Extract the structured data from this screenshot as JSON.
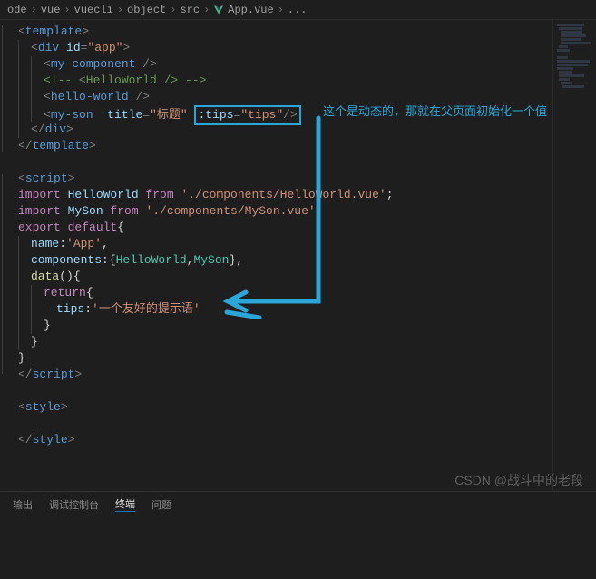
{
  "breadcrumb": {
    "items": [
      "ode",
      "vue",
      "vuecli",
      "object",
      "src",
      "App.vue",
      "..."
    ]
  },
  "code": {
    "lines": [
      {
        "indent": 0,
        "tokens": [
          {
            "c": "tag",
            "t": "<"
          },
          {
            "c": "tagname",
            "t": "template"
          },
          {
            "c": "tag",
            "t": ">"
          }
        ]
      },
      {
        "indent": 1,
        "tokens": [
          {
            "c": "tag",
            "t": "<"
          },
          {
            "c": "tagname",
            "t": "div "
          },
          {
            "c": "attr",
            "t": "id"
          },
          {
            "c": "tag",
            "t": "="
          },
          {
            "c": "string",
            "t": "\"app\""
          },
          {
            "c": "tag",
            "t": ">"
          }
        ]
      },
      {
        "indent": 2,
        "tokens": [
          {
            "c": "tag",
            "t": "<"
          },
          {
            "c": "tagname",
            "t": "my-component"
          },
          {
            "c": "tag",
            "t": " />"
          }
        ]
      },
      {
        "indent": 2,
        "tokens": [
          {
            "c": "comment",
            "t": "<!-- <HelloWorld /> -->"
          }
        ]
      },
      {
        "indent": 2,
        "tokens": [
          {
            "c": "tag",
            "t": "<"
          },
          {
            "c": "tagname",
            "t": "hello-world"
          },
          {
            "c": "tag",
            "t": " />"
          }
        ]
      },
      {
        "indent": 2,
        "special": "myson"
      },
      {
        "indent": 1,
        "tokens": [
          {
            "c": "tag",
            "t": "</"
          },
          {
            "c": "tagname",
            "t": "div"
          },
          {
            "c": "tag",
            "t": ">"
          }
        ]
      },
      {
        "indent": 0,
        "tokens": [
          {
            "c": "tag",
            "t": "</"
          },
          {
            "c": "tagname",
            "t": "template"
          },
          {
            "c": "tag",
            "t": ">"
          }
        ]
      },
      {
        "indent": 0,
        "tokens": []
      },
      {
        "indent": 0,
        "tokens": [
          {
            "c": "tag",
            "t": "<"
          },
          {
            "c": "tagname",
            "t": "script"
          },
          {
            "c": "tag",
            "t": ">"
          }
        ]
      },
      {
        "indent": 0,
        "tokens": [
          {
            "c": "keyword",
            "t": "import "
          },
          {
            "c": "identifier",
            "t": "HelloWorld "
          },
          {
            "c": "keyword",
            "t": "from "
          },
          {
            "c": "string",
            "t": "'./components/HelloWorld.vue'"
          },
          {
            "c": "punct",
            "t": ";"
          }
        ]
      },
      {
        "indent": 0,
        "tokens": [
          {
            "c": "keyword",
            "t": "import "
          },
          {
            "c": "identifier",
            "t": "MySon "
          },
          {
            "c": "keyword",
            "t": "from "
          },
          {
            "c": "string",
            "t": "'./components/MySon.vue'"
          }
        ]
      },
      {
        "indent": 0,
        "tokens": [
          {
            "c": "keyword",
            "t": "export default"
          },
          {
            "c": "punct",
            "t": "{"
          }
        ]
      },
      {
        "indent": 1,
        "tokens": [
          {
            "c": "identifier",
            "t": "name"
          },
          {
            "c": "punct",
            "t": ":"
          },
          {
            "c": "string",
            "t": "'App'"
          },
          {
            "c": "punct",
            "t": ","
          }
        ]
      },
      {
        "indent": 1,
        "tokens": [
          {
            "c": "identifier",
            "t": "components"
          },
          {
            "c": "punct",
            "t": ":{"
          },
          {
            "c": "class",
            "t": "HelloWorld"
          },
          {
            "c": "punct",
            "t": ","
          },
          {
            "c": "class",
            "t": "MySon"
          },
          {
            "c": "punct",
            "t": "},"
          }
        ]
      },
      {
        "indent": 1,
        "tokens": [
          {
            "c": "func",
            "t": "data"
          },
          {
            "c": "punct",
            "t": "(){"
          }
        ]
      },
      {
        "indent": 2,
        "tokens": [
          {
            "c": "keyword",
            "t": "return"
          },
          {
            "c": "punct",
            "t": "{"
          }
        ]
      },
      {
        "indent": 3,
        "tokens": [
          {
            "c": "identifier",
            "t": "tips"
          },
          {
            "c": "punct",
            "t": ":"
          },
          {
            "c": "string",
            "t": "'一个友好的提示语'"
          }
        ]
      },
      {
        "indent": 2,
        "tokens": [
          {
            "c": "punct",
            "t": "}"
          }
        ]
      },
      {
        "indent": 1,
        "tokens": [
          {
            "c": "punct",
            "t": "}"
          }
        ]
      },
      {
        "indent": 0,
        "tokens": [
          {
            "c": "punct",
            "t": "}"
          }
        ]
      },
      {
        "indent": 0,
        "tokens": [
          {
            "c": "tag",
            "t": "</"
          },
          {
            "c": "tagname",
            "t": "script"
          },
          {
            "c": "tag",
            "t": ">"
          }
        ]
      },
      {
        "indent": 0,
        "tokens": []
      },
      {
        "indent": 0,
        "tokens": [
          {
            "c": "tag",
            "t": "<"
          },
          {
            "c": "tagname",
            "t": "style"
          },
          {
            "c": "tag",
            "t": ">"
          }
        ]
      },
      {
        "indent": 0,
        "tokens": []
      },
      {
        "indent": 0,
        "tokens": [
          {
            "c": "tag",
            "t": "</"
          },
          {
            "c": "tagname",
            "t": "style"
          },
          {
            "c": "tag",
            "t": ">"
          }
        ]
      },
      {
        "indent": 0,
        "tokens": []
      }
    ],
    "myson_line": {
      "prefix_open": "<",
      "tagname": "my-son  ",
      "attr1": "title",
      "eq": "=",
      "val1": "\"标题\"",
      "space": " ",
      "attr2": ":tips",
      "val2": "\"tips\"",
      "close": "/>"
    }
  },
  "annotation": {
    "text": "这个是动态的，那就在父页面初始化一个值"
  },
  "watermark": "CSDN @战斗中的老段",
  "bottom_tabs": [
    "输出",
    "调试控制台",
    "终端",
    "问题"
  ],
  "colors": {
    "highlight": "#2aa6d8"
  }
}
